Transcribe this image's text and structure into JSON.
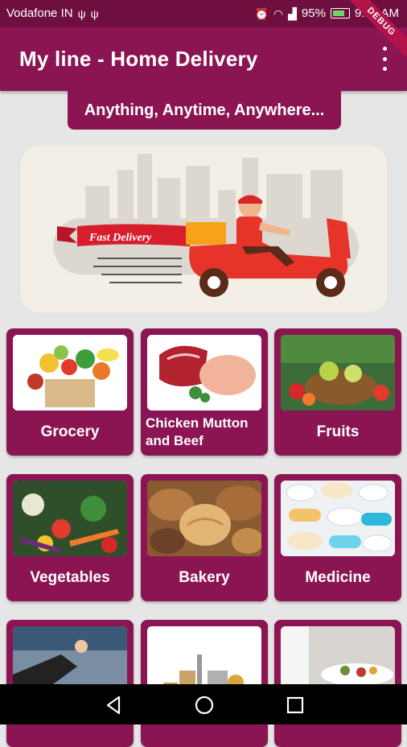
{
  "status_bar": {
    "carrier": "Vodafone IN",
    "battery": "95%",
    "time": "9:1_ AM",
    "time_visible": "9:13 AM"
  },
  "app_bar": {
    "title": "My line - Home Delivery",
    "debug_label": "DEBUG"
  },
  "tagline": "Anything, Anytime, Anywhere...",
  "banner": {
    "ribbon_text": "Fast Delivery"
  },
  "categories": [
    {
      "label": "Grocery"
    },
    {
      "label": "Chicken Mutton and Beef"
    },
    {
      "label": "Fruits"
    },
    {
      "label": "Vegetables"
    },
    {
      "label": "Bakery"
    },
    {
      "label": "Medicine"
    },
    {
      "label": ""
    },
    {
      "label": ""
    },
    {
      "label": ""
    }
  ],
  "colors": {
    "primary": "#8b1553",
    "status": "#6e0f3f",
    "background": "#e6e6e6"
  }
}
